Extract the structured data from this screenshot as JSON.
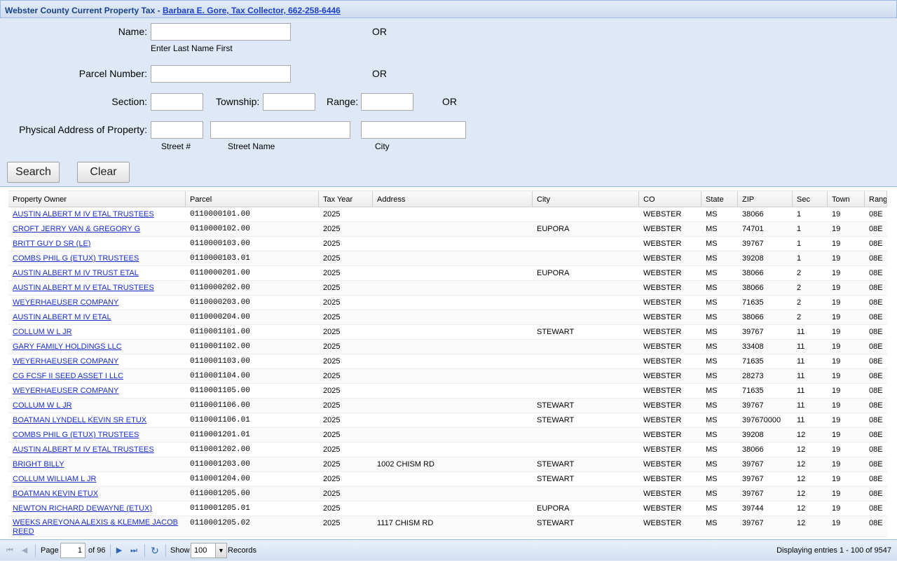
{
  "header": {
    "title": "Webster County Current Property Tax - ",
    "collector_link": "Barbara E. Gore, Tax Collector, 662-258-6446"
  },
  "form": {
    "name_label": "Name:",
    "name_hint": "Enter Last Name First",
    "parcel_label": "Parcel Number:",
    "section_label": "Section:",
    "township_label": "Township:",
    "range_label": "Range:",
    "address_label": "Physical Address of Property:",
    "street_num_hint": "Street #",
    "street_name_hint": "Street Name",
    "city_hint": "City",
    "or_text": "OR",
    "search_label": "Search",
    "clear_label": "Clear"
  },
  "grid": {
    "columns": [
      "Property Owner",
      "Parcel",
      "Tax Year",
      "Address",
      "City",
      "CO",
      "State",
      "ZIP",
      "Sec",
      "Town",
      "Rang"
    ],
    "rows": [
      [
        "AUSTIN ALBERT M IV ETAL TRUSTEES",
        "0110000101.00",
        "2025",
        "",
        "",
        "WEBSTER",
        "MS",
        "38066",
        "1",
        "19",
        "08E"
      ],
      [
        "CROFT JERRY VAN & GREGORY G",
        "0110000102.00",
        "2025",
        "",
        "EUPORA",
        "WEBSTER",
        "MS",
        "74701",
        "1",
        "19",
        "08E"
      ],
      [
        "BRITT GUY D SR (LE)",
        "0110000103.00",
        "2025",
        "",
        "",
        "WEBSTER",
        "MS",
        "39767",
        "1",
        "19",
        "08E"
      ],
      [
        "COMBS PHIL G (ETUX) TRUSTEES",
        "0110000103.01",
        "2025",
        "",
        "",
        "WEBSTER",
        "MS",
        "39208",
        "1",
        "19",
        "08E"
      ],
      [
        "AUSTIN ALBERT M IV TRUST ETAL",
        "0110000201.00",
        "2025",
        "",
        "EUPORA",
        "WEBSTER",
        "MS",
        "38066",
        "2",
        "19",
        "08E"
      ],
      [
        "AUSTIN ALBERT M IV ETAL TRUSTEES",
        "0110000202.00",
        "2025",
        "",
        "",
        "WEBSTER",
        "MS",
        "38066",
        "2",
        "19",
        "08E"
      ],
      [
        "WEYERHAEUSER COMPANY",
        "0110000203.00",
        "2025",
        "",
        "",
        "WEBSTER",
        "MS",
        "71635",
        "2",
        "19",
        "08E"
      ],
      [
        "AUSTIN ALBERT M IV ETAL",
        "0110000204.00",
        "2025",
        "",
        "",
        "WEBSTER",
        "MS",
        "38066",
        "2",
        "19",
        "08E"
      ],
      [
        "COLLUM W L JR",
        "0110001101.00",
        "2025",
        "",
        "STEWART",
        "WEBSTER",
        "MS",
        "39767",
        "11",
        "19",
        "08E"
      ],
      [
        "GARY FAMILY HOLDINGS LLC",
        "0110001102.00",
        "2025",
        "",
        "",
        "WEBSTER",
        "MS",
        "33408",
        "11",
        "19",
        "08E"
      ],
      [
        "WEYERHAEUSER COMPANY",
        "0110001103.00",
        "2025",
        "",
        "",
        "WEBSTER",
        "MS",
        "71635",
        "11",
        "19",
        "08E"
      ],
      [
        "CG FCSF II SEED ASSET I LLC",
        "0110001104.00",
        "2025",
        "",
        "",
        "WEBSTER",
        "MS",
        "28273",
        "11",
        "19",
        "08E"
      ],
      [
        "WEYERHAEUSER COMPANY",
        "0110001105.00",
        "2025",
        "",
        "",
        "WEBSTER",
        "MS",
        "71635",
        "11",
        "19",
        "08E"
      ],
      [
        "COLLUM W L JR",
        "0110001106.00",
        "2025",
        "",
        "STEWART",
        "WEBSTER",
        "MS",
        "39767",
        "11",
        "19",
        "08E"
      ],
      [
        "BOATMAN LYNDELL KEVIN SR ETUX",
        "0110001106.01",
        "2025",
        "",
        "STEWART",
        "WEBSTER",
        "MS",
        "397670000",
        "11",
        "19",
        "08E"
      ],
      [
        "COMBS PHIL G (ETUX) TRUSTEES",
        "0110001201.01",
        "2025",
        "",
        "",
        "WEBSTER",
        "MS",
        "39208",
        "12",
        "19",
        "08E"
      ],
      [
        "AUSTIN ALBERT M IV ETAL TRUSTEES",
        "0110001202.00",
        "2025",
        "",
        "",
        "WEBSTER",
        "MS",
        "38066",
        "12",
        "19",
        "08E"
      ],
      [
        "BRIGHT BILLY",
        "0110001203.00",
        "2025",
        "1002 CHISM RD",
        "STEWART",
        "WEBSTER",
        "MS",
        "39767",
        "12",
        "19",
        "08E"
      ],
      [
        "COLLUM WILLIAM L JR",
        "0110001204.00",
        "2025",
        "",
        "STEWART",
        "WEBSTER",
        "MS",
        "39767",
        "12",
        "19",
        "08E"
      ],
      [
        "BOATMAN KEVIN ETUX",
        "0110001205.00",
        "2025",
        "",
        "",
        "WEBSTER",
        "MS",
        "39767",
        "12",
        "19",
        "08E"
      ],
      [
        "NEWTON RICHARD DEWAYNE (ETUX)",
        "0110001205.01",
        "2025",
        "",
        "EUPORA",
        "WEBSTER",
        "MS",
        "39744",
        "12",
        "19",
        "08E"
      ],
      [
        "WEEKS AREYONA ALEXIS & KLEMME JACOB REED",
        "0110001205.02",
        "2025",
        "1117 CHISM RD",
        "STEWART",
        "WEBSTER",
        "MS",
        "39767",
        "12",
        "19",
        "08E"
      ]
    ]
  },
  "pager": {
    "page_label": "Page",
    "page_value": "1",
    "of_text": "of 96",
    "show_label": "Show",
    "show_value": "100",
    "records_label": "Records",
    "display_text": "Displaying entries 1 - 100 of 9547"
  },
  "icons": {
    "first": "first-page-icon",
    "prev": "prev-page-icon",
    "next": "next-page-icon",
    "last": "last-page-icon",
    "refresh": "refresh-icon"
  },
  "colors": {
    "link": "#1a2fcc",
    "panel_bg": "#dfe8f6",
    "header_text": "#15428b"
  }
}
